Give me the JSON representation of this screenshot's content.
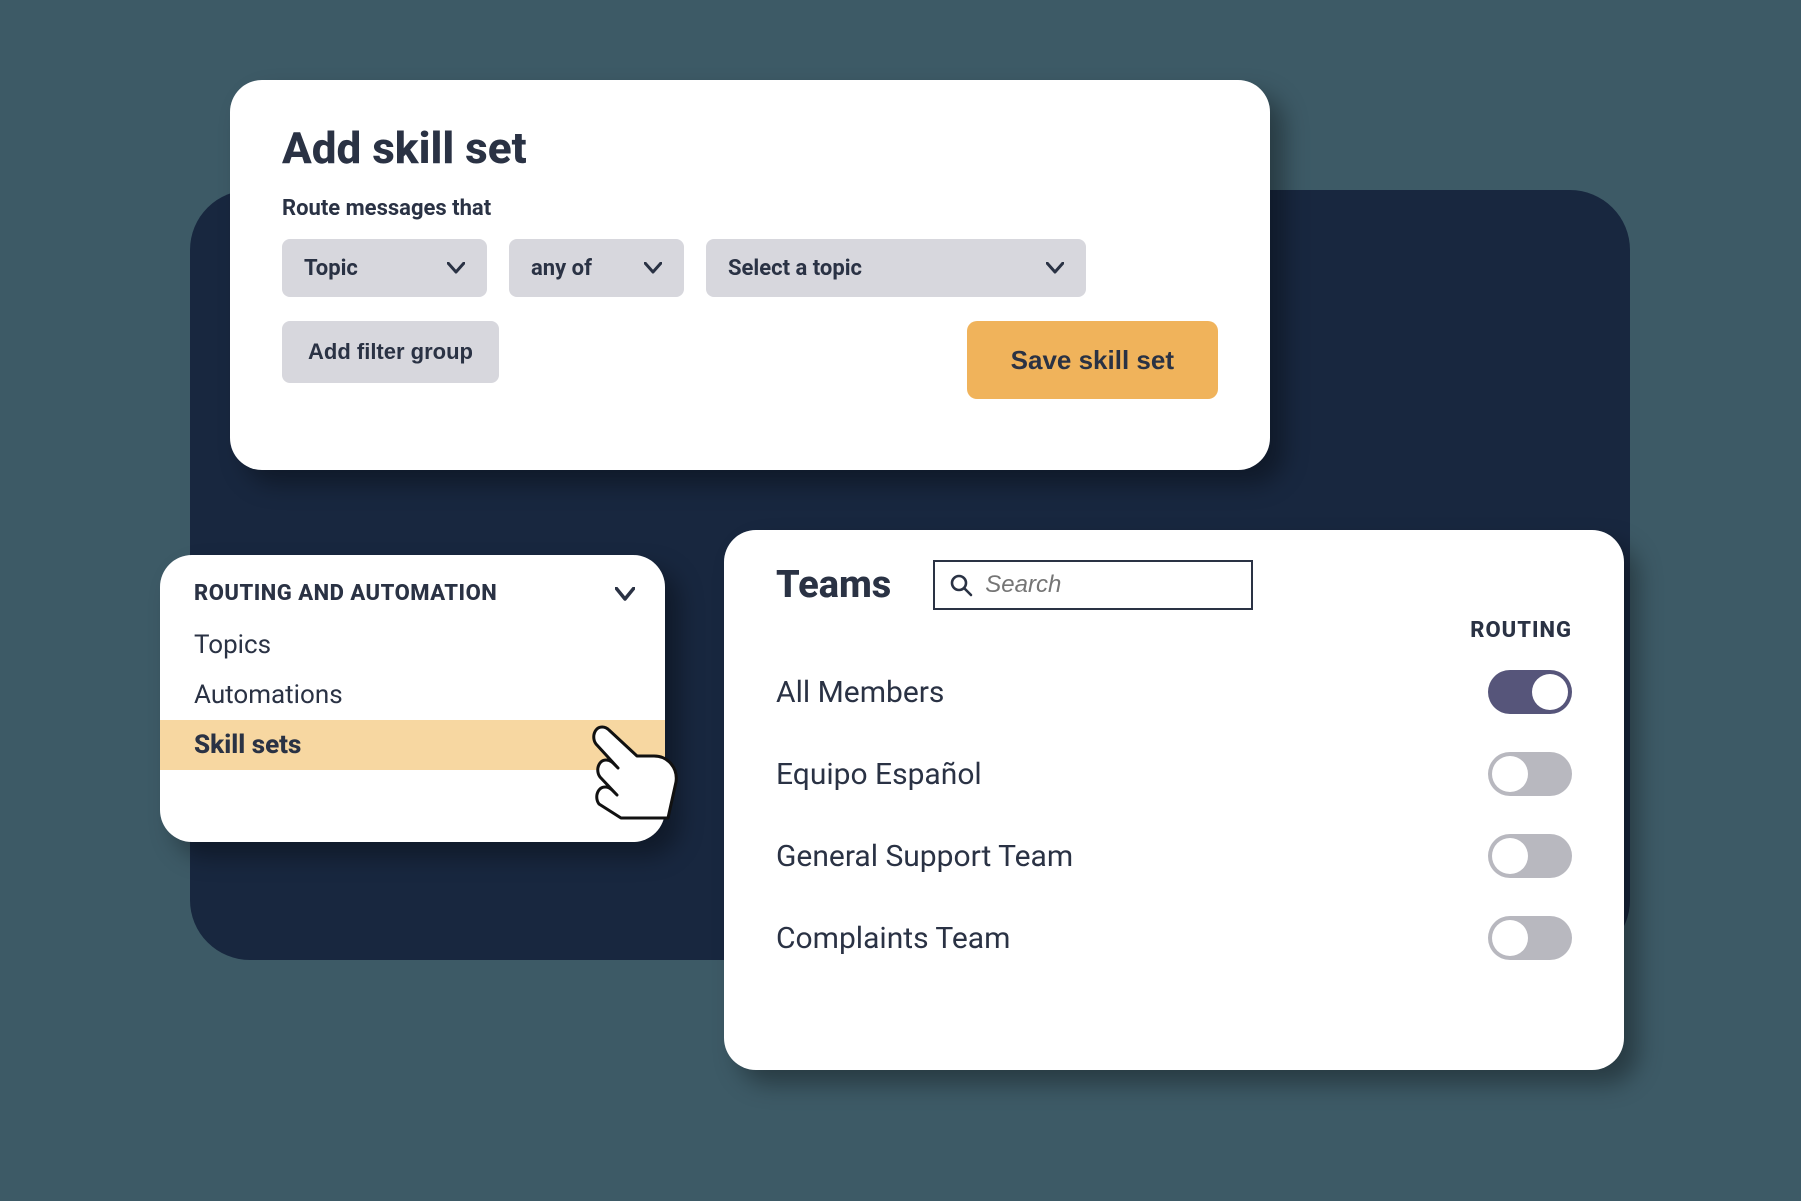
{
  "skill": {
    "title": "Add skill set",
    "subtitle": "Route messages that",
    "select_topic": "Topic",
    "select_match": "any of",
    "select_value": "Select a topic",
    "add_filter_label": "Add filter group",
    "save_label": "Save skill set"
  },
  "sidebar": {
    "header": "ROUTING AND AUTOMATION",
    "items": [
      "Topics",
      "Automations",
      "Skill sets"
    ],
    "active_index": 2
  },
  "teams": {
    "title": "Teams",
    "search_placeholder": "Search",
    "routing_label": "ROUTING",
    "rows": [
      {
        "name": "All Members",
        "routing": true
      },
      {
        "name": "Equipo Español",
        "routing": false
      },
      {
        "name": "General Support Team",
        "routing": false
      },
      {
        "name": "Complaints Team",
        "routing": false
      }
    ]
  }
}
